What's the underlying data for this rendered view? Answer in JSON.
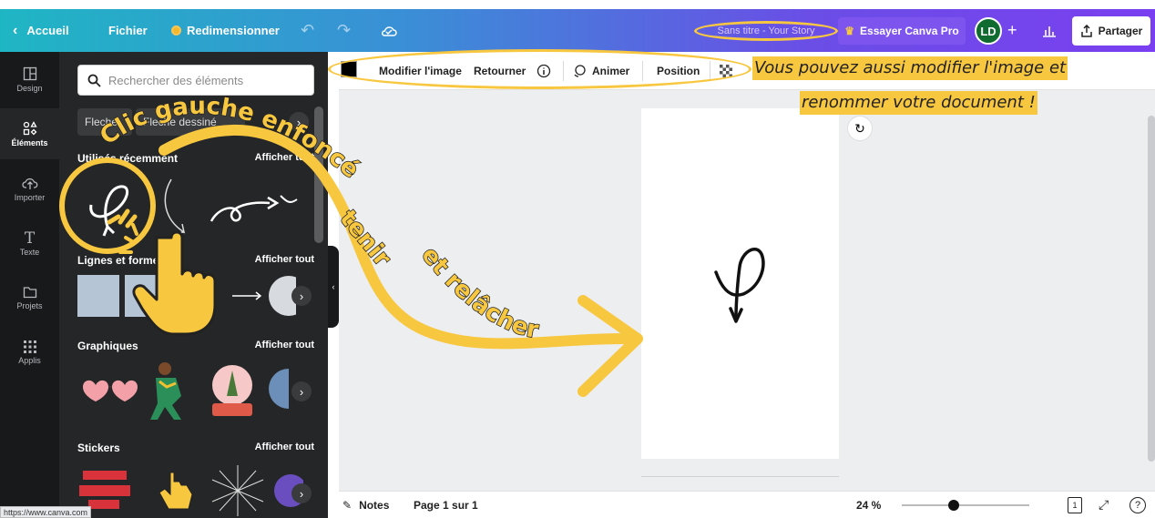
{
  "topbar": {
    "home_label": "Accueil",
    "file_label": "Fichier",
    "resize_label": "Redimensionner",
    "document_title": "Sans titre - Your Story",
    "try_pro_label": "Essayer Canva Pro",
    "avatar_initials": "LD",
    "share_label": "Partager"
  },
  "rail": {
    "items": [
      {
        "label": "Design",
        "icon": "layout-icon"
      },
      {
        "label": "Éléments",
        "icon": "shapes-icon"
      },
      {
        "label": "Importer",
        "icon": "upload-cloud-icon"
      },
      {
        "label": "Texte",
        "icon": "text-icon"
      },
      {
        "label": "Projets",
        "icon": "folder-icon"
      },
      {
        "label": "Applis",
        "icon": "grid-icon"
      }
    ]
  },
  "panel": {
    "search_placeholder": "Rechercher des éléments",
    "chips": [
      "Fleche",
      "Fleche dessiné"
    ],
    "sections": [
      {
        "title": "Utilisés récemment",
        "see_all": "Afficher tout"
      },
      {
        "title": "Lignes et formes",
        "see_all": "Afficher tout"
      },
      {
        "title": "Graphiques",
        "see_all": "Afficher tout"
      },
      {
        "title": "Stickers",
        "see_all": "Afficher tout"
      }
    ]
  },
  "context_bar": {
    "edit_image": "Modifier l'image",
    "flip": "Retourner",
    "animate": "Animer",
    "position": "Position"
  },
  "footer": {
    "notes": "Notes",
    "page_indicator": "Page 1 sur 1",
    "zoom": "24 %",
    "zoom_fraction": 0.24,
    "page_count_badge": "1"
  },
  "annotations": {
    "instruction_1": "Clic gauche enfoncé",
    "instruction_2": "tenir",
    "instruction_3": "et relâcher",
    "tip_line_1": "Vous pouvez aussi modifier l'image et",
    "tip_line_2": "renommer votre document !"
  },
  "status_url": "https://www.canva.com",
  "colors": {
    "accent_yellow": "#f8c740",
    "panel_bg": "#252627",
    "rail_bg": "#18191b"
  }
}
